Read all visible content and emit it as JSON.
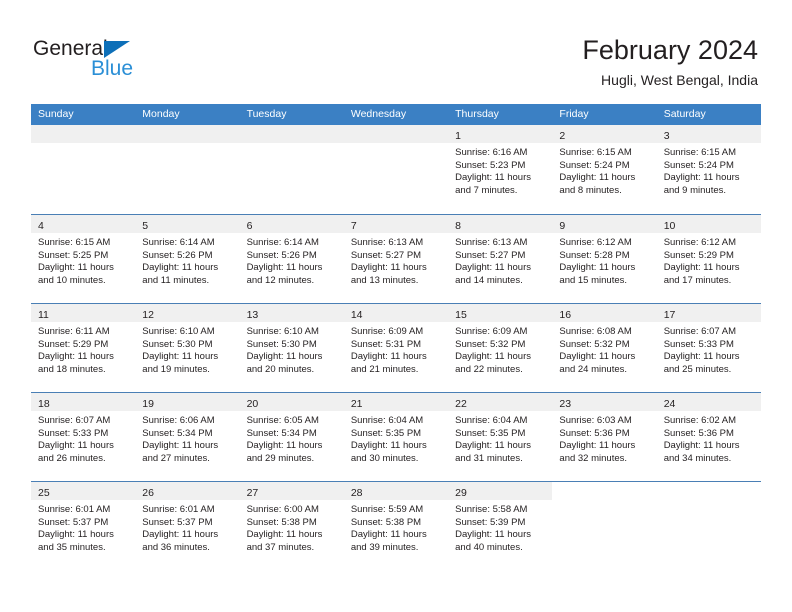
{
  "brand": {
    "name_top": "General",
    "name_bottom": "Blue",
    "triangle_color": "#0d6fb8",
    "blue_color": "#2b8fd6"
  },
  "header": {
    "month_title": "February 2024",
    "location": "Hugli, West Bengal, India"
  },
  "colors": {
    "header_bar": "#3b80c4",
    "day_band": "#f0f0f0",
    "row_divider": "#4a7fb5",
    "text": "#231f20"
  },
  "weekdays": [
    "Sunday",
    "Monday",
    "Tuesday",
    "Wednesday",
    "Thursday",
    "Friday",
    "Saturday"
  ],
  "weeks": [
    [
      {
        "day": "",
        "sunrise": "",
        "sunset": "",
        "daylight_line1": "",
        "daylight_line2": "",
        "empty": true,
        "blank": false
      },
      {
        "day": "",
        "sunrise": "",
        "sunset": "",
        "daylight_line1": "",
        "daylight_line2": "",
        "empty": true,
        "blank": false
      },
      {
        "day": "",
        "sunrise": "",
        "sunset": "",
        "daylight_line1": "",
        "daylight_line2": "",
        "empty": true,
        "blank": false
      },
      {
        "day": "",
        "sunrise": "",
        "sunset": "",
        "daylight_line1": "",
        "daylight_line2": "",
        "empty": true,
        "blank": false
      },
      {
        "day": "1",
        "sunrise": "Sunrise: 6:16 AM",
        "sunset": "Sunset: 5:23 PM",
        "daylight_line1": "Daylight: 11 hours",
        "daylight_line2": "and 7 minutes.",
        "empty": false,
        "blank": false
      },
      {
        "day": "2",
        "sunrise": "Sunrise: 6:15 AM",
        "sunset": "Sunset: 5:24 PM",
        "daylight_line1": "Daylight: 11 hours",
        "daylight_line2": "and 8 minutes.",
        "empty": false,
        "blank": false
      },
      {
        "day": "3",
        "sunrise": "Sunrise: 6:15 AM",
        "sunset": "Sunset: 5:24 PM",
        "daylight_line1": "Daylight: 11 hours",
        "daylight_line2": "and 9 minutes.",
        "empty": false,
        "blank": false
      }
    ],
    [
      {
        "day": "4",
        "sunrise": "Sunrise: 6:15 AM",
        "sunset": "Sunset: 5:25 PM",
        "daylight_line1": "Daylight: 11 hours",
        "daylight_line2": "and 10 minutes.",
        "empty": false,
        "blank": false
      },
      {
        "day": "5",
        "sunrise": "Sunrise: 6:14 AM",
        "sunset": "Sunset: 5:26 PM",
        "daylight_line1": "Daylight: 11 hours",
        "daylight_line2": "and 11 minutes.",
        "empty": false,
        "blank": false
      },
      {
        "day": "6",
        "sunrise": "Sunrise: 6:14 AM",
        "sunset": "Sunset: 5:26 PM",
        "daylight_line1": "Daylight: 11 hours",
        "daylight_line2": "and 12 minutes.",
        "empty": false,
        "blank": false
      },
      {
        "day": "7",
        "sunrise": "Sunrise: 6:13 AM",
        "sunset": "Sunset: 5:27 PM",
        "daylight_line1": "Daylight: 11 hours",
        "daylight_line2": "and 13 minutes.",
        "empty": false,
        "blank": false
      },
      {
        "day": "8",
        "sunrise": "Sunrise: 6:13 AM",
        "sunset": "Sunset: 5:27 PM",
        "daylight_line1": "Daylight: 11 hours",
        "daylight_line2": "and 14 minutes.",
        "empty": false,
        "blank": false
      },
      {
        "day": "9",
        "sunrise": "Sunrise: 6:12 AM",
        "sunset": "Sunset: 5:28 PM",
        "daylight_line1": "Daylight: 11 hours",
        "daylight_line2": "and 15 minutes.",
        "empty": false,
        "blank": false
      },
      {
        "day": "10",
        "sunrise": "Sunrise: 6:12 AM",
        "sunset": "Sunset: 5:29 PM",
        "daylight_line1": "Daylight: 11 hours",
        "daylight_line2": "and 17 minutes.",
        "empty": false,
        "blank": false
      }
    ],
    [
      {
        "day": "11",
        "sunrise": "Sunrise: 6:11 AM",
        "sunset": "Sunset: 5:29 PM",
        "daylight_line1": "Daylight: 11 hours",
        "daylight_line2": "and 18 minutes.",
        "empty": false,
        "blank": false
      },
      {
        "day": "12",
        "sunrise": "Sunrise: 6:10 AM",
        "sunset": "Sunset: 5:30 PM",
        "daylight_line1": "Daylight: 11 hours",
        "daylight_line2": "and 19 minutes.",
        "empty": false,
        "blank": false
      },
      {
        "day": "13",
        "sunrise": "Sunrise: 6:10 AM",
        "sunset": "Sunset: 5:30 PM",
        "daylight_line1": "Daylight: 11 hours",
        "daylight_line2": "and 20 minutes.",
        "empty": false,
        "blank": false
      },
      {
        "day": "14",
        "sunrise": "Sunrise: 6:09 AM",
        "sunset": "Sunset: 5:31 PM",
        "daylight_line1": "Daylight: 11 hours",
        "daylight_line2": "and 21 minutes.",
        "empty": false,
        "blank": false
      },
      {
        "day": "15",
        "sunrise": "Sunrise: 6:09 AM",
        "sunset": "Sunset: 5:32 PM",
        "daylight_line1": "Daylight: 11 hours",
        "daylight_line2": "and 22 minutes.",
        "empty": false,
        "blank": false
      },
      {
        "day": "16",
        "sunrise": "Sunrise: 6:08 AM",
        "sunset": "Sunset: 5:32 PM",
        "daylight_line1": "Daylight: 11 hours",
        "daylight_line2": "and 24 minutes.",
        "empty": false,
        "blank": false
      },
      {
        "day": "17",
        "sunrise": "Sunrise: 6:07 AM",
        "sunset": "Sunset: 5:33 PM",
        "daylight_line1": "Daylight: 11 hours",
        "daylight_line2": "and 25 minutes.",
        "empty": false,
        "blank": false
      }
    ],
    [
      {
        "day": "18",
        "sunrise": "Sunrise: 6:07 AM",
        "sunset": "Sunset: 5:33 PM",
        "daylight_line1": "Daylight: 11 hours",
        "daylight_line2": "and 26 minutes.",
        "empty": false,
        "blank": false
      },
      {
        "day": "19",
        "sunrise": "Sunrise: 6:06 AM",
        "sunset": "Sunset: 5:34 PM",
        "daylight_line1": "Daylight: 11 hours",
        "daylight_line2": "and 27 minutes.",
        "empty": false,
        "blank": false
      },
      {
        "day": "20",
        "sunrise": "Sunrise: 6:05 AM",
        "sunset": "Sunset: 5:34 PM",
        "daylight_line1": "Daylight: 11 hours",
        "daylight_line2": "and 29 minutes.",
        "empty": false,
        "blank": false
      },
      {
        "day": "21",
        "sunrise": "Sunrise: 6:04 AM",
        "sunset": "Sunset: 5:35 PM",
        "daylight_line1": "Daylight: 11 hours",
        "daylight_line2": "and 30 minutes.",
        "empty": false,
        "blank": false
      },
      {
        "day": "22",
        "sunrise": "Sunrise: 6:04 AM",
        "sunset": "Sunset: 5:35 PM",
        "daylight_line1": "Daylight: 11 hours",
        "daylight_line2": "and 31 minutes.",
        "empty": false,
        "blank": false
      },
      {
        "day": "23",
        "sunrise": "Sunrise: 6:03 AM",
        "sunset": "Sunset: 5:36 PM",
        "daylight_line1": "Daylight: 11 hours",
        "daylight_line2": "and 32 minutes.",
        "empty": false,
        "blank": false
      },
      {
        "day": "24",
        "sunrise": "Sunrise: 6:02 AM",
        "sunset": "Sunset: 5:36 PM",
        "daylight_line1": "Daylight: 11 hours",
        "daylight_line2": "and 34 minutes.",
        "empty": false,
        "blank": false
      }
    ],
    [
      {
        "day": "25",
        "sunrise": "Sunrise: 6:01 AM",
        "sunset": "Sunset: 5:37 PM",
        "daylight_line1": "Daylight: 11 hours",
        "daylight_line2": "and 35 minutes.",
        "empty": false,
        "blank": false
      },
      {
        "day": "26",
        "sunrise": "Sunrise: 6:01 AM",
        "sunset": "Sunset: 5:37 PM",
        "daylight_line1": "Daylight: 11 hours",
        "daylight_line2": "and 36 minutes.",
        "empty": false,
        "blank": false
      },
      {
        "day": "27",
        "sunrise": "Sunrise: 6:00 AM",
        "sunset": "Sunset: 5:38 PM",
        "daylight_line1": "Daylight: 11 hours",
        "daylight_line2": "and 37 minutes.",
        "empty": false,
        "blank": false
      },
      {
        "day": "28",
        "sunrise": "Sunrise: 5:59 AM",
        "sunset": "Sunset: 5:38 PM",
        "daylight_line1": "Daylight: 11 hours",
        "daylight_line2": "and 39 minutes.",
        "empty": false,
        "blank": false
      },
      {
        "day": "29",
        "sunrise": "Sunrise: 5:58 AM",
        "sunset": "Sunset: 5:39 PM",
        "daylight_line1": "Daylight: 11 hours",
        "daylight_line2": "and 40 minutes.",
        "empty": false,
        "blank": false
      },
      {
        "day": "",
        "sunrise": "",
        "sunset": "",
        "daylight_line1": "",
        "daylight_line2": "",
        "empty": false,
        "blank": true
      },
      {
        "day": "",
        "sunrise": "",
        "sunset": "",
        "daylight_line1": "",
        "daylight_line2": "",
        "empty": false,
        "blank": true
      }
    ]
  ]
}
